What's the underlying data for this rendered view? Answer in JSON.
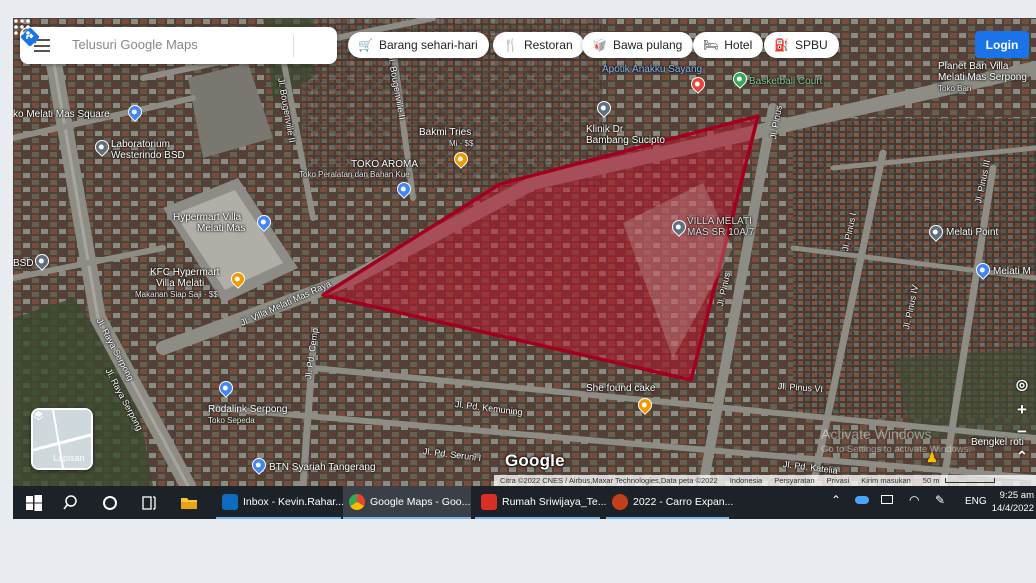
{
  "search": {
    "placeholder": "Telusuri Google Maps"
  },
  "chips": [
    {
      "label": "Barang sehari-hari",
      "icon": "cart-icon"
    },
    {
      "label": "Restoran",
      "icon": "restaurant-icon"
    },
    {
      "label": "Bawa pulang",
      "icon": "takeout-icon"
    },
    {
      "label": "Hotel",
      "icon": "hotel-icon"
    },
    {
      "label": "SPBU",
      "icon": "gas-station-icon"
    }
  ],
  "header": {
    "login_label": "Login"
  },
  "places": {
    "apotik": "Apotik Anakku Sayang",
    "basketball": "Basketball Court",
    "planet_ban_1": "Planet Ban Villa",
    "planet_ban_2": "Melati Mas Serpong",
    "toko_ban": "Toko Ban",
    "melati_square": "ko Melati Mas Square",
    "lab_1": "Laboratorium",
    "lab_2": "Westerindo BSD",
    "bakmi": "Bakmi Tries",
    "bakmi_sub": "Mi · $$",
    "toko_aroma": "TOKO AROMA",
    "toko_aroma_sub": "Toko Peralatan dan Bahan Kue",
    "klinik_1": "Klinik Dr",
    "klinik_2": "Bambang Sucipto",
    "hypermart_1": "Hypermart Villa",
    "hypermart_2": "Melati Mas",
    "villa_1": "VILLA MELATI",
    "villa_2": "MAS SR 10A/7",
    "melati_point": "Melati Point",
    "bsd": "BSD",
    "kfc_1": "KFC Hypermart",
    "kfc_2": "Villa Melati",
    "kfc_sub": "Makanan Siap Saji · $$",
    "melati_right": "Melati M",
    "she_found_cake": "She found cake",
    "rodalink": "Rodalink Serpong",
    "rodalink_sub": "Toko Sepeda",
    "btn": "BTN Syariah Tangerang",
    "bangkelroti": "Bengkel roti"
  },
  "roads": {
    "bougenville_ii": "Jl. Bougenville II",
    "bougenville_iii": "Jl. Bougenville II",
    "villa_melati": "Jl. Villa Melati Mas Raya",
    "raya_serpong_1": "Jl. Raya Serpong",
    "raya_serpong_2": "Jl. Raya Serpong",
    "pinus_top": "Jl. Pinus",
    "pinus_mid": "Jl. Pinus",
    "pinus_i": "Jl. Pinus I",
    "pinus_iii": "Jl. Pinus III",
    "pinus_iv": "Jl. Pinus IV",
    "pinus_vi": "Jl. Pinus VI",
    "pd_cemp": "Jl. Pd. Cemp",
    "pd_kemuning": "Jl. Pd. Kemuning",
    "pd_seruni": "Jl. Pd. Seruni I",
    "pd_katelia": "Jl. Pd. Katelia"
  },
  "layers": {
    "label": "Lapisan"
  },
  "logo": "Google",
  "attribution": {
    "imagery": "Citra ©2022 CNES / Airbus,Maxar Technologies,Data peta ©2022",
    "country": "Indonesia",
    "terms": "Persyaratan",
    "privacy": "Privasi",
    "feedback": "Kirim masukan",
    "scale": "50 m"
  },
  "watermark": {
    "title": "Activate Windows",
    "subtitle": "Go to Settings to activate Windows."
  },
  "taskbar": {
    "apps": [
      {
        "label": "Inbox - Kevin.Rahar...",
        "color": "#0f6cbd"
      },
      {
        "label": "Google Maps - Goo...",
        "color": "#34a853"
      },
      {
        "label": "Rumah Sriwijaya_Te...",
        "color": "#d93025"
      },
      {
        "label": "2022 - Carro Expan...",
        "color": "#c43e1c"
      }
    ],
    "language": "ENG",
    "time": "9:25 am",
    "date": "14/4/2022"
  },
  "colors": {
    "polygon_stroke": "#a3001e",
    "polygon_fill": "#c0102b",
    "accent": "#1a73e8"
  }
}
